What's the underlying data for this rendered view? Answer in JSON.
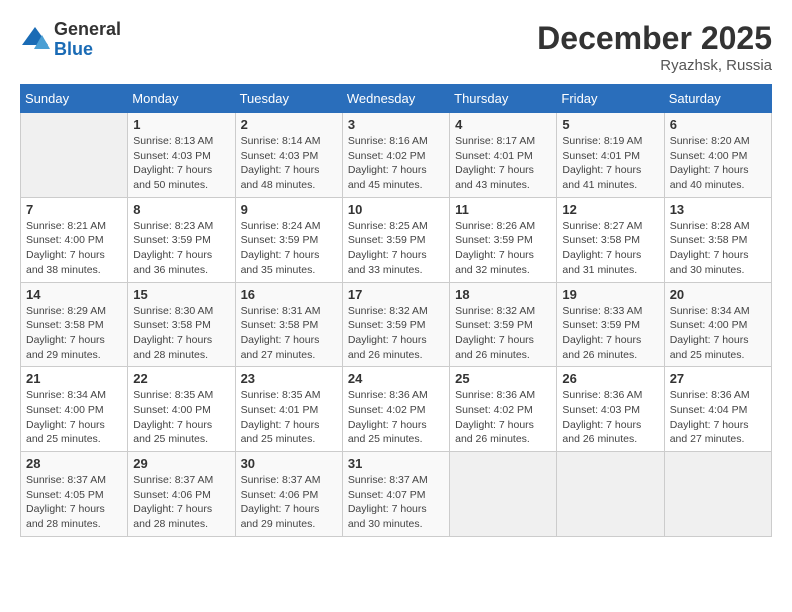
{
  "logo": {
    "general": "General",
    "blue": "Blue"
  },
  "title": "December 2025",
  "location": "Ryazhsk, Russia",
  "days_of_week": [
    "Sunday",
    "Monday",
    "Tuesday",
    "Wednesday",
    "Thursday",
    "Friday",
    "Saturday"
  ],
  "weeks": [
    [
      {
        "day": "",
        "info": ""
      },
      {
        "day": "1",
        "info": "Sunrise: 8:13 AM\nSunset: 4:03 PM\nDaylight: 7 hours\nand 50 minutes."
      },
      {
        "day": "2",
        "info": "Sunrise: 8:14 AM\nSunset: 4:03 PM\nDaylight: 7 hours\nand 48 minutes."
      },
      {
        "day": "3",
        "info": "Sunrise: 8:16 AM\nSunset: 4:02 PM\nDaylight: 7 hours\nand 45 minutes."
      },
      {
        "day": "4",
        "info": "Sunrise: 8:17 AM\nSunset: 4:01 PM\nDaylight: 7 hours\nand 43 minutes."
      },
      {
        "day": "5",
        "info": "Sunrise: 8:19 AM\nSunset: 4:01 PM\nDaylight: 7 hours\nand 41 minutes."
      },
      {
        "day": "6",
        "info": "Sunrise: 8:20 AM\nSunset: 4:00 PM\nDaylight: 7 hours\nand 40 minutes."
      }
    ],
    [
      {
        "day": "7",
        "info": "Sunrise: 8:21 AM\nSunset: 4:00 PM\nDaylight: 7 hours\nand 38 minutes."
      },
      {
        "day": "8",
        "info": "Sunrise: 8:23 AM\nSunset: 3:59 PM\nDaylight: 7 hours\nand 36 minutes."
      },
      {
        "day": "9",
        "info": "Sunrise: 8:24 AM\nSunset: 3:59 PM\nDaylight: 7 hours\nand 35 minutes."
      },
      {
        "day": "10",
        "info": "Sunrise: 8:25 AM\nSunset: 3:59 PM\nDaylight: 7 hours\nand 33 minutes."
      },
      {
        "day": "11",
        "info": "Sunrise: 8:26 AM\nSunset: 3:59 PM\nDaylight: 7 hours\nand 32 minutes."
      },
      {
        "day": "12",
        "info": "Sunrise: 8:27 AM\nSunset: 3:58 PM\nDaylight: 7 hours\nand 31 minutes."
      },
      {
        "day": "13",
        "info": "Sunrise: 8:28 AM\nSunset: 3:58 PM\nDaylight: 7 hours\nand 30 minutes."
      }
    ],
    [
      {
        "day": "14",
        "info": "Sunrise: 8:29 AM\nSunset: 3:58 PM\nDaylight: 7 hours\nand 29 minutes."
      },
      {
        "day": "15",
        "info": "Sunrise: 8:30 AM\nSunset: 3:58 PM\nDaylight: 7 hours\nand 28 minutes."
      },
      {
        "day": "16",
        "info": "Sunrise: 8:31 AM\nSunset: 3:58 PM\nDaylight: 7 hours\nand 27 minutes."
      },
      {
        "day": "17",
        "info": "Sunrise: 8:32 AM\nSunset: 3:59 PM\nDaylight: 7 hours\nand 26 minutes."
      },
      {
        "day": "18",
        "info": "Sunrise: 8:32 AM\nSunset: 3:59 PM\nDaylight: 7 hours\nand 26 minutes."
      },
      {
        "day": "19",
        "info": "Sunrise: 8:33 AM\nSunset: 3:59 PM\nDaylight: 7 hours\nand 26 minutes."
      },
      {
        "day": "20",
        "info": "Sunrise: 8:34 AM\nSunset: 4:00 PM\nDaylight: 7 hours\nand 25 minutes."
      }
    ],
    [
      {
        "day": "21",
        "info": "Sunrise: 8:34 AM\nSunset: 4:00 PM\nDaylight: 7 hours\nand 25 minutes."
      },
      {
        "day": "22",
        "info": "Sunrise: 8:35 AM\nSunset: 4:00 PM\nDaylight: 7 hours\nand 25 minutes."
      },
      {
        "day": "23",
        "info": "Sunrise: 8:35 AM\nSunset: 4:01 PM\nDaylight: 7 hours\nand 25 minutes."
      },
      {
        "day": "24",
        "info": "Sunrise: 8:36 AM\nSunset: 4:02 PM\nDaylight: 7 hours\nand 25 minutes."
      },
      {
        "day": "25",
        "info": "Sunrise: 8:36 AM\nSunset: 4:02 PM\nDaylight: 7 hours\nand 26 minutes."
      },
      {
        "day": "26",
        "info": "Sunrise: 8:36 AM\nSunset: 4:03 PM\nDaylight: 7 hours\nand 26 minutes."
      },
      {
        "day": "27",
        "info": "Sunrise: 8:36 AM\nSunset: 4:04 PM\nDaylight: 7 hours\nand 27 minutes."
      }
    ],
    [
      {
        "day": "28",
        "info": "Sunrise: 8:37 AM\nSunset: 4:05 PM\nDaylight: 7 hours\nand 28 minutes."
      },
      {
        "day": "29",
        "info": "Sunrise: 8:37 AM\nSunset: 4:06 PM\nDaylight: 7 hours\nand 28 minutes."
      },
      {
        "day": "30",
        "info": "Sunrise: 8:37 AM\nSunset: 4:06 PM\nDaylight: 7 hours\nand 29 minutes."
      },
      {
        "day": "31",
        "info": "Sunrise: 8:37 AM\nSunset: 4:07 PM\nDaylight: 7 hours\nand 30 minutes."
      },
      {
        "day": "",
        "info": ""
      },
      {
        "day": "",
        "info": ""
      },
      {
        "day": "",
        "info": ""
      }
    ]
  ]
}
